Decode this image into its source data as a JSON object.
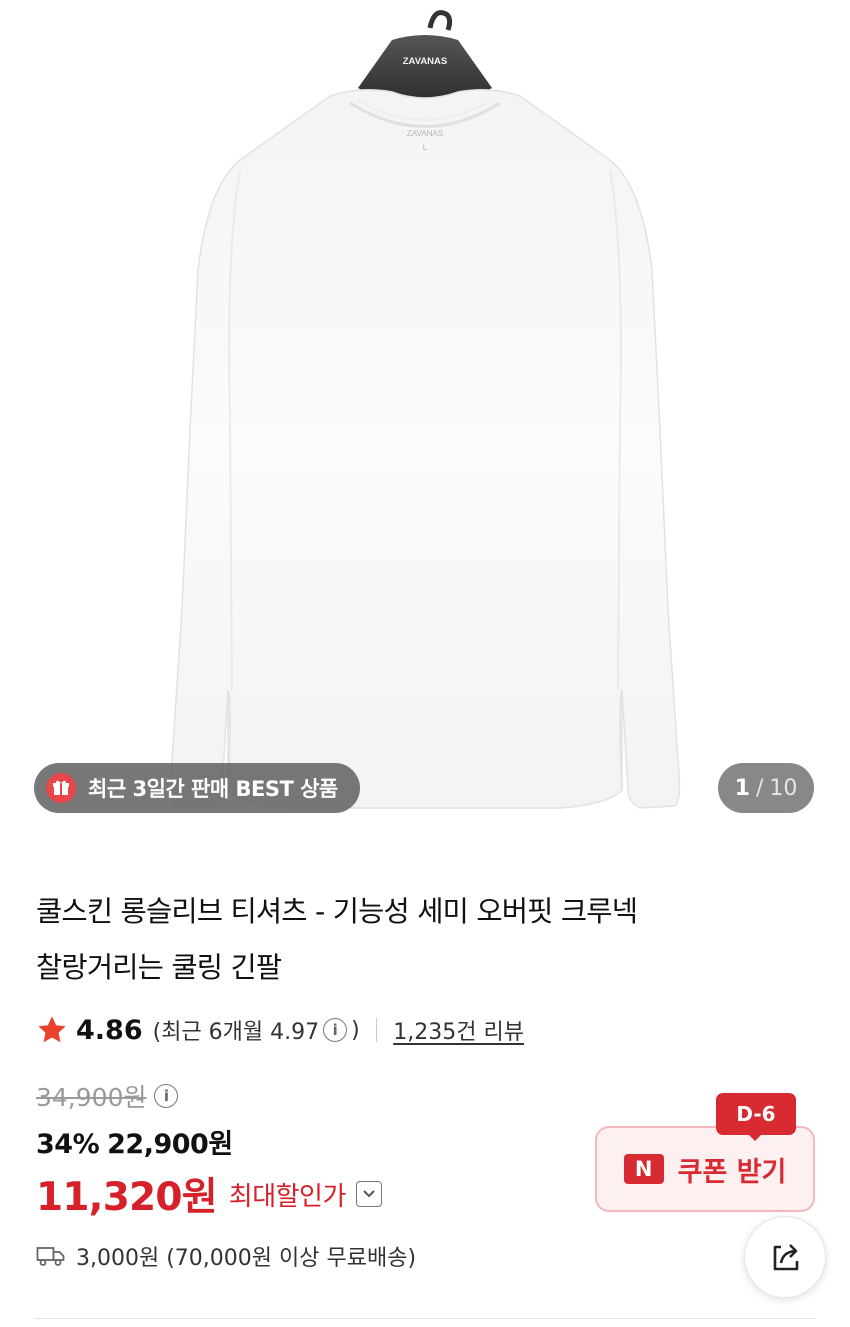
{
  "product_image": {
    "hanger_brand": "ZAVANAS",
    "label_brand": "ZAVANAS",
    "label_size": "L"
  },
  "badge": {
    "icon": "gift-icon",
    "text": "최근 3일간 판매 BEST 상품"
  },
  "image_counter": {
    "current": "1",
    "separator": "/",
    "total": "10"
  },
  "product": {
    "title_line1": "쿨스킨 롱슬리브 티셔츠 - 기능성 세미 오버핏 크루넥",
    "title_line2": "찰랑거리는 쿨링 긴팔"
  },
  "rating": {
    "score": "4.86",
    "recent_text": "(최근 6개월 4.97",
    "recent_close": ")",
    "reviews_link": "1,235건 리뷰",
    "star_color": "#e8412c"
  },
  "price": {
    "original": "34,900원",
    "discount_percent": "34%",
    "sale_price": "22,900원",
    "max_discount_price": "11,320원",
    "max_discount_label": "최대할인가"
  },
  "coupon": {
    "dday": "D-6",
    "n_logo": "N",
    "label": "쿠폰 받기",
    "accent_color": "#d72a31"
  },
  "shipping": {
    "icon": "truck-icon",
    "text": "3,000원 (70,000원 이상 무료배송)"
  },
  "share": {
    "icon": "share-icon"
  }
}
